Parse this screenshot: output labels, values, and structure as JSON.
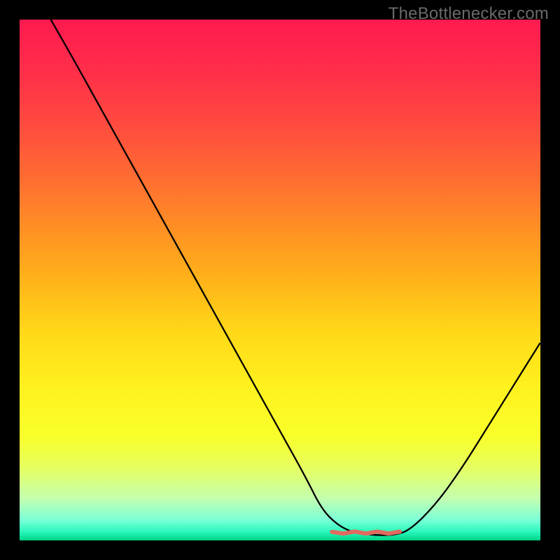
{
  "watermark": "TheBottlenecker.com",
  "chart_data": {
    "type": "line",
    "title": "",
    "xlabel": "",
    "ylabel": "",
    "xlim": [
      0,
      100
    ],
    "ylim": [
      0,
      100
    ],
    "background_gradient": {
      "stops": [
        {
          "offset": 0.0,
          "color": "#ff1a4f"
        },
        {
          "offset": 0.1,
          "color": "#ff2e49"
        },
        {
          "offset": 0.2,
          "color": "#ff4a3f"
        },
        {
          "offset": 0.3,
          "color": "#ff6b32"
        },
        {
          "offset": 0.4,
          "color": "#ff8f24"
        },
        {
          "offset": 0.5,
          "color": "#ffb319"
        },
        {
          "offset": 0.6,
          "color": "#ffd818"
        },
        {
          "offset": 0.7,
          "color": "#fff01e"
        },
        {
          "offset": 0.8,
          "color": "#f9ff2a"
        },
        {
          "offset": 0.86,
          "color": "#e6ff60"
        },
        {
          "offset": 0.92,
          "color": "#c3ffb0"
        },
        {
          "offset": 0.96,
          "color": "#7cffd6"
        },
        {
          "offset": 0.985,
          "color": "#2dffc6"
        },
        {
          "offset": 1.0,
          "color": "#00e38e"
        }
      ]
    },
    "series": [
      {
        "name": "bottleneck-curve",
        "color": "#000000",
        "x": [
          6,
          10,
          15,
          20,
          25,
          30,
          35,
          40,
          45,
          50,
          55,
          58,
          61,
          64,
          68,
          72,
          75,
          80,
          85,
          90,
          95,
          100
        ],
        "y": [
          100,
          93,
          84,
          75,
          66,
          57,
          48,
          39,
          30,
          21,
          12,
          6,
          3,
          1.5,
          1,
          1,
          2,
          7,
          14,
          22,
          30,
          38
        ]
      },
      {
        "name": "optimal-marker",
        "type": "marker-strip",
        "color": "#e26a60",
        "x_range": [
          60,
          73
        ],
        "y": 1.5
      }
    ],
    "green_band": {
      "y_from": 0,
      "y_to": 3
    }
  }
}
